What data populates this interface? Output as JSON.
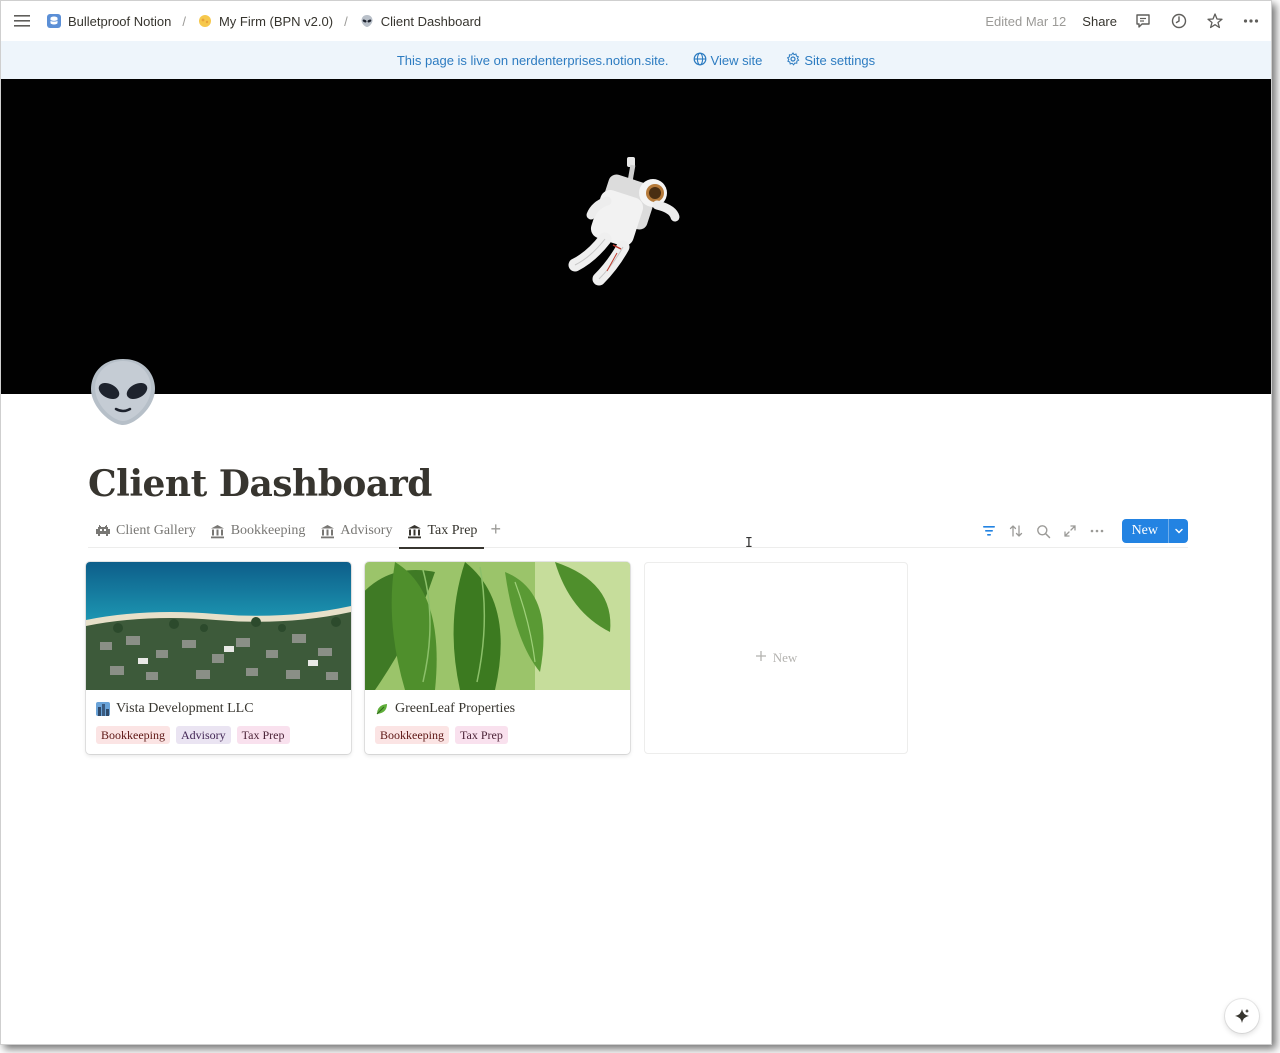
{
  "breadcrumb": [
    {
      "label": "Bulletproof Notion",
      "icon": "database-icon"
    },
    {
      "label": "My Firm (BPN v2.0)",
      "icon": "sun-icon"
    },
    {
      "label": "Client Dashboard",
      "icon": "alien-icon"
    }
  ],
  "breadcrumb_separator": "/",
  "topbar": {
    "edited": "Edited Mar 12",
    "share": "Share"
  },
  "banner": {
    "message": "This page is live on nerdenterprises.notion.site.",
    "view_site": "View site",
    "site_settings": "Site settings"
  },
  "page": {
    "title": "Client Dashboard",
    "icon": "alien-emoji"
  },
  "tabs": [
    {
      "label": "Client Gallery",
      "icon": "space-invader-icon",
      "active": false
    },
    {
      "label": "Bookkeeping",
      "icon": "bank-icon",
      "active": false
    },
    {
      "label": "Advisory",
      "icon": "bank-icon",
      "active": false
    },
    {
      "label": "Tax Prep",
      "icon": "bank-icon",
      "active": true
    }
  ],
  "tab_add": "+",
  "new_button": {
    "label": "New"
  },
  "cards": [
    {
      "title": "Vista Development LLC",
      "cover": "aerial coastline",
      "tags": [
        "Bookkeeping",
        "Advisory",
        "Tax Prep"
      ]
    },
    {
      "title": "GreenLeaf Properties",
      "cover": "green leaves",
      "tags": [
        "Bookkeeping",
        "Tax Prep"
      ]
    }
  ],
  "new_card": {
    "label": "New"
  },
  "colors": {
    "accent": "#2383e2",
    "banner_bg": "#eef5fb",
    "banner_text": "#2d7cc1",
    "tag_bookkeeping": "#fbe4e4",
    "tag_advisory": "#eae4f2",
    "tag_taxprep": "#f9e1ee"
  }
}
